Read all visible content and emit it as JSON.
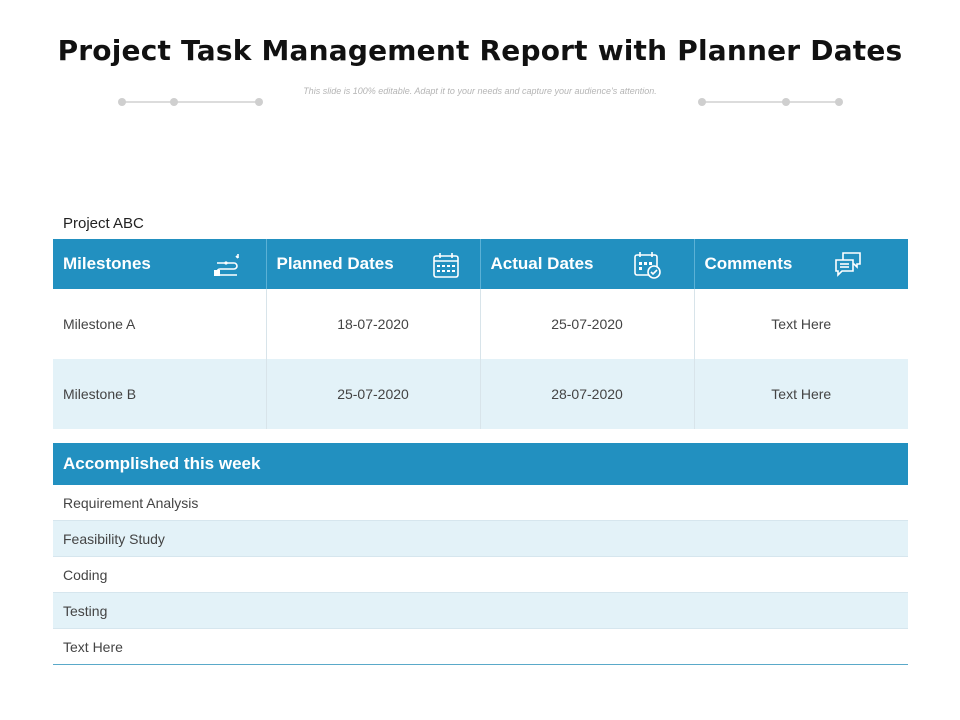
{
  "title": "Project Task Management Report with Planner Dates",
  "subtitle": "This slide is 100% editable. Adapt it to your needs and capture your audience's attention.",
  "project_label": "Project ABC",
  "milestone_table": {
    "headers": [
      {
        "label": "Milestones",
        "icon": "milestones-icon"
      },
      {
        "label": "Planned Dates",
        "icon": "calendar-icon"
      },
      {
        "label": "Actual Dates",
        "icon": "calendar-check-icon"
      },
      {
        "label": "Comments",
        "icon": "chat-bubbles-icon"
      }
    ],
    "rows": [
      [
        "Milestone A",
        "18-07-2020",
        "25-07-2020",
        "Text Here"
      ],
      [
        "Milestone B",
        "25-07-2020",
        "28-07-2020",
        "Text Here"
      ]
    ]
  },
  "accomplished_table": {
    "header": "Accomplished this week",
    "items": [
      "Requirement Analysis",
      "Feasibility Study",
      "Coding",
      "Testing",
      "Text Here"
    ]
  },
  "colors": {
    "header_bg": "#2290c0",
    "alt_row_bg": "#e3f2f8",
    "title_text": "#111111"
  }
}
